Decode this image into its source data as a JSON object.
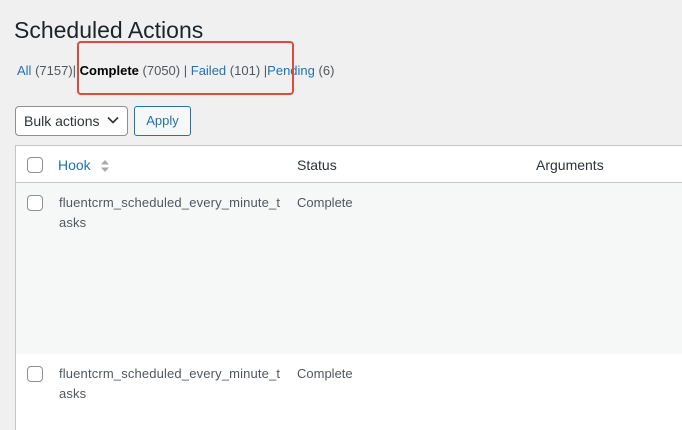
{
  "page": {
    "title": "Scheduled Actions"
  },
  "filters": {
    "all_label": "All",
    "all_count": "(7157)",
    "complete_label": "Complete",
    "complete_count": "(7050)",
    "failed_label": "Failed",
    "failed_count": "(101)",
    "pending_label": "Pending",
    "pending_count": "(6)",
    "separator": "|",
    "current": "Complete"
  },
  "toolbar": {
    "bulk_actions_label": "Bulk actions",
    "apply_label": "Apply"
  },
  "table": {
    "columns": {
      "hook": "Hook",
      "status": "Status",
      "arguments": "Arguments"
    },
    "rows": [
      {
        "hook": "fluentcrm_scheduled_every_minute_tasks",
        "status": "Complete",
        "arguments": ""
      },
      {
        "hook": "fluentcrm_scheduled_every_minute_tasks",
        "status": "Complete",
        "arguments": ""
      }
    ]
  },
  "colors": {
    "link": "#2271b1",
    "highlight": "#e04a3a",
    "background": "#f0f0f1"
  },
  "icons": {
    "sort": "sort-icon",
    "dropdown": "chevron-down-icon"
  }
}
